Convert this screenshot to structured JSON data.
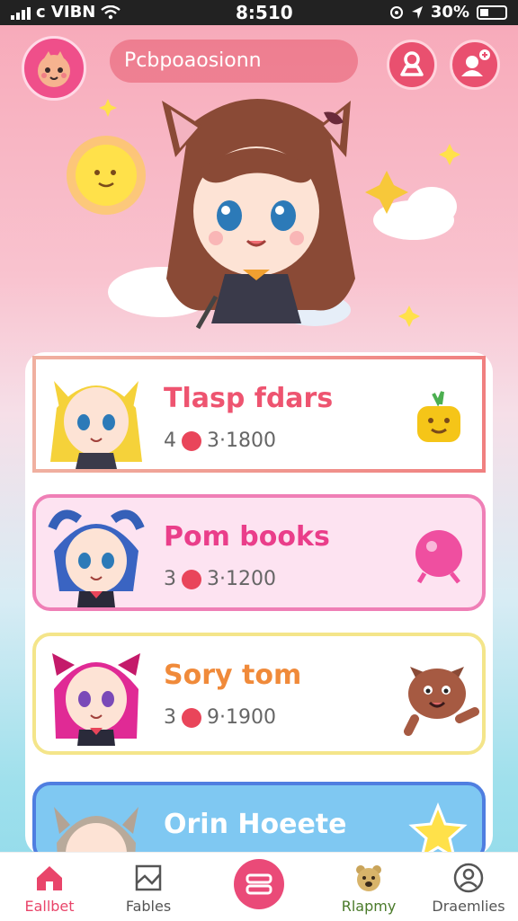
{
  "status_bar": {
    "carrier": "c VIBN",
    "time": "8:510",
    "battery": "30%"
  },
  "header": {
    "search_placeholder": "Pcbpoaosionn"
  },
  "cards": [
    {
      "title": "Tlasp fdars",
      "stats_left": "4",
      "stats_right": "3·1800",
      "title_color": "#ee5470",
      "border": "#f19b86",
      "bg": "#ffffff"
    },
    {
      "title": "Pom books",
      "stats_left": "3",
      "stats_right": "3·1200",
      "title_color": "#ea3e8a",
      "border": "#ef7fb6",
      "bg": "#fde3f1"
    },
    {
      "title": "Sory tom",
      "stats_left": "3",
      "stats_right": "9·1900",
      "title_color": "#f08a3a",
      "border": "#f4e58a",
      "bg": "#ffffff"
    },
    {
      "title": "Orin Hoeete",
      "title_color": "#ffffff",
      "border": "#4f7ee0",
      "bg": "#7fc8f2"
    }
  ],
  "tabs": [
    {
      "label": "Eallbet",
      "icon": "home-icon",
      "color": "#e9456a"
    },
    {
      "label": "Fables",
      "icon": "book-icon",
      "color": "#555555"
    },
    {
      "label": "",
      "icon": "center-action-icon",
      "color": "#ffffff"
    },
    {
      "label": "Rlapmy",
      "icon": "bear-icon",
      "color": "#555555"
    },
    {
      "label": "Draemlies",
      "icon": "profile-icon",
      "color": "#555555"
    }
  ]
}
